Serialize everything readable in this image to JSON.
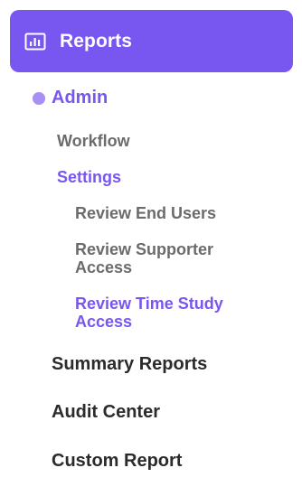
{
  "colors": {
    "accent": "#7856f0",
    "accent_dot": "#a88ff4",
    "muted_text": "#6b6b6b",
    "dark_text": "#2b2b2b"
  },
  "reports": {
    "label": "Reports",
    "icon": "bar-chart-icon"
  },
  "admin": {
    "label": "Admin"
  },
  "admin_children": [
    {
      "label": "Workflow",
      "active": false
    },
    {
      "label": "Settings",
      "active": true
    }
  ],
  "settings_children": [
    {
      "label": "Review End Users",
      "active": false
    },
    {
      "label": "Review Supporter Access",
      "active": false
    },
    {
      "label": "Review Time Study Access",
      "active": true
    }
  ],
  "other_items": [
    {
      "label": "Summary Reports"
    },
    {
      "label": "Audit Center"
    },
    {
      "label": "Custom Report"
    }
  ]
}
